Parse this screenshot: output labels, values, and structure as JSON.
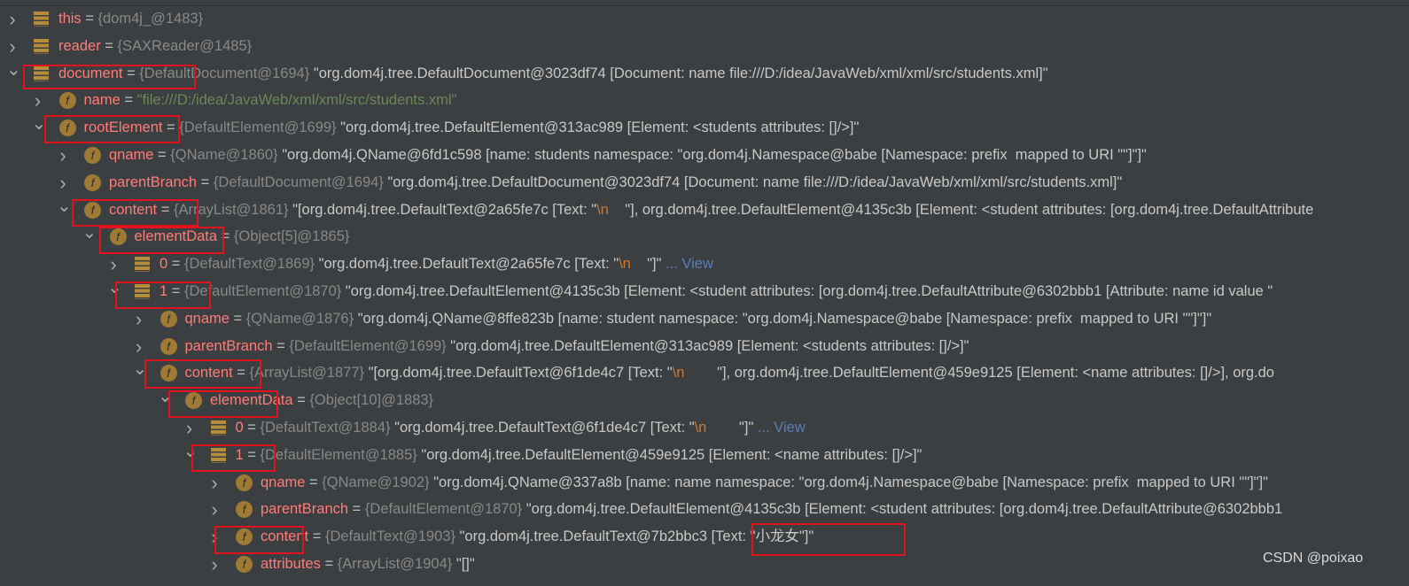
{
  "variables": [
    {
      "level": 0,
      "expanded": false,
      "icon": "array",
      "name": "this",
      "type": "{dom4j_@1483}",
      "value": []
    },
    {
      "level": 0,
      "expanded": false,
      "icon": "array",
      "name": "reader",
      "type": "{SAXReader@1485}",
      "value": []
    },
    {
      "level": 0,
      "expanded": true,
      "icon": "array",
      "name": "document",
      "type": "{DefaultDocument@1694}",
      "value": [
        {
          "t": "\"org.dom4j.tree.DefaultDocument@3023df74 [Document: name file:///D:/idea/JavaWeb/xml/xml/src/students.xml]\""
        }
      ]
    },
    {
      "level": 1,
      "expanded": false,
      "icon": "field",
      "name": "name",
      "type": "",
      "value": [
        {
          "t": "\"file:///D:/idea/JavaWeb/xml/xml/src/students.xml\"",
          "c": "str"
        }
      ]
    },
    {
      "level": 1,
      "expanded": true,
      "icon": "field",
      "name": "rootElement",
      "type": "{DefaultElement@1699}",
      "value": [
        {
          "t": "\"org.dom4j.tree.DefaultElement@313ac989 [Element: <students attributes: []/>]\""
        }
      ]
    },
    {
      "level": 2,
      "expanded": false,
      "icon": "field",
      "name": "qname",
      "type": "{QName@1860}",
      "value": [
        {
          "t": "\"org.dom4j.QName@6fd1c598 [name: students namespace: \"org.dom4j.Namespace@babe [Namespace: prefix  mapped to URI \"\"]\"]\""
        }
      ]
    },
    {
      "level": 2,
      "expanded": false,
      "icon": "field",
      "name": "parentBranch",
      "type": "{DefaultDocument@1694}",
      "value": [
        {
          "t": "\"org.dom4j.tree.DefaultDocument@3023df74 [Document: name file:///D:/idea/JavaWeb/xml/xml/src/students.xml]\""
        }
      ]
    },
    {
      "level": 2,
      "expanded": true,
      "icon": "field",
      "name": "content",
      "type": "{ArrayList@1861}",
      "value": [
        {
          "t": "\"[org.dom4j.tree.DefaultText@2a65fe7c [Text: \""
        },
        {
          "t": "\\n",
          "c": "esc"
        },
        {
          "t": "    \"], org.dom4j.tree.DefaultElement@4135c3b [Element: <student attributes: [org.dom4j.tree.DefaultAttribute"
        }
      ]
    },
    {
      "level": 3,
      "expanded": true,
      "icon": "field",
      "name": "elementData",
      "type": "{Object[5]@1865}",
      "value": []
    },
    {
      "level": 4,
      "expanded": false,
      "icon": "array",
      "name": "0",
      "type": "{DefaultText@1869}",
      "value": [
        {
          "t": "\"org.dom4j.tree.DefaultText@2a65fe7c [Text: \""
        },
        {
          "t": "\\n",
          "c": "esc"
        },
        {
          "t": "    \"]\""
        },
        {
          "t": " ... View",
          "c": "link"
        }
      ]
    },
    {
      "level": 4,
      "expanded": true,
      "icon": "array",
      "name": "1",
      "type": "{DefaultElement@1870}",
      "value": [
        {
          "t": "\"org.dom4j.tree.DefaultElement@4135c3b [Element: <student attributes: [org.dom4j.tree.DefaultAttribute@6302bbb1 [Attribute: name id value \""
        }
      ]
    },
    {
      "level": 5,
      "expanded": false,
      "icon": "field",
      "name": "qname",
      "type": "{QName@1876}",
      "value": [
        {
          "t": "\"org.dom4j.QName@8ffe823b [name: student namespace: \"org.dom4j.Namespace@babe [Namespace: prefix  mapped to URI \"\"]\"]\""
        }
      ]
    },
    {
      "level": 5,
      "expanded": false,
      "icon": "field",
      "name": "parentBranch",
      "type": "{DefaultElement@1699}",
      "value": [
        {
          "t": "\"org.dom4j.tree.DefaultElement@313ac989 [Element: <students attributes: []/>]\""
        }
      ]
    },
    {
      "level": 5,
      "expanded": true,
      "icon": "field",
      "name": "content",
      "type": "{ArrayList@1877}",
      "value": [
        {
          "t": "\"[org.dom4j.tree.DefaultText@6f1de4c7 [Text: \""
        },
        {
          "t": "\\n",
          "c": "esc"
        },
        {
          "t": "        \"], org.dom4j.tree.DefaultElement@459e9125 [Element: <name attributes: []/>], org.do"
        }
      ]
    },
    {
      "level": 6,
      "expanded": true,
      "icon": "field",
      "name": "elementData",
      "type": "{Object[10]@1883}",
      "value": []
    },
    {
      "level": 7,
      "expanded": false,
      "icon": "array",
      "name": "0",
      "type": "{DefaultText@1884}",
      "value": [
        {
          "t": "\"org.dom4j.tree.DefaultText@6f1de4c7 [Text: \""
        },
        {
          "t": "\\n",
          "c": "esc"
        },
        {
          "t": "        \"]\""
        },
        {
          "t": " ... View",
          "c": "link"
        }
      ]
    },
    {
      "level": 7,
      "expanded": true,
      "icon": "array",
      "name": "1",
      "type": "{DefaultElement@1885}",
      "value": [
        {
          "t": "\"org.dom4j.tree.DefaultElement@459e9125 [Element: <name attributes: []/>]\""
        }
      ]
    },
    {
      "level": 8,
      "expanded": false,
      "icon": "field",
      "name": "qname",
      "type": "{QName@1902}",
      "value": [
        {
          "t": "\"org.dom4j.QName@337a8b [name: name namespace: \"org.dom4j.Namespace@babe [Namespace: prefix  mapped to URI \"\"]\"]\""
        }
      ]
    },
    {
      "level": 8,
      "expanded": false,
      "icon": "field",
      "name": "parentBranch",
      "type": "{DefaultElement@1870}",
      "value": [
        {
          "t": "\"org.dom4j.tree.DefaultElement@4135c3b [Element: <student attributes: [org.dom4j.tree.DefaultAttribute@6302bbb1"
        }
      ]
    },
    {
      "level": 8,
      "expanded": false,
      "icon": "field",
      "name": "content",
      "type": "{DefaultText@1903}",
      "value": [
        {
          "t": "\"org.dom4j.tree.DefaultText@7b2bbc3 [Text: \"小龙女\"]\""
        }
      ]
    },
    {
      "level": 8,
      "expanded": false,
      "icon": "field",
      "name": "attributes",
      "type": "{ArrayList@1904}",
      "value": [
        {
          "t": "\"[]\""
        }
      ]
    }
  ],
  "watermark": "CSDN @poixao",
  "colors": {
    "background": "#3c3f41",
    "name": "#ff7b77",
    "type": "#888888",
    "string": "#6a8759",
    "escape": "#cc7832",
    "link": "#5a7dbb",
    "highlight_box": "#e0141e"
  }
}
